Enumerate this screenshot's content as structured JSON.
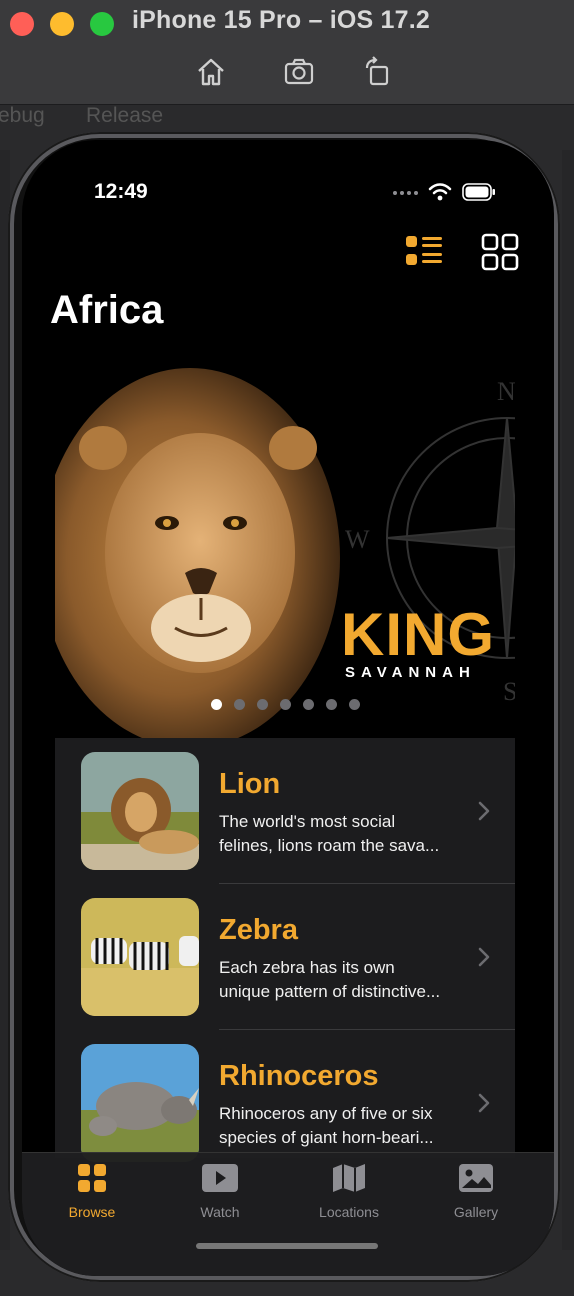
{
  "window": {
    "title": "iPhone 15 Pro – iOS 17.2",
    "behind_labels": [
      "ebug",
      "Release"
    ]
  },
  "toolbar": {
    "icons": [
      "home-icon",
      "screenshot-icon",
      "rotate-icon"
    ]
  },
  "status_bar": {
    "time": "12:49"
  },
  "header": {
    "title": "Africa",
    "view_toggles": [
      "list-view-icon",
      "grid-view-icon"
    ]
  },
  "hero": {
    "headline": "KING",
    "subheadline": "SAVANNAH",
    "compass_letters": [
      "N",
      "W",
      "S"
    ],
    "page_count": 7,
    "current_page": 1
  },
  "animals": [
    {
      "name": "Lion",
      "desc_line1": "The world's most social",
      "desc_line2": "felines, lions roam the sava..."
    },
    {
      "name": "Zebra",
      "desc_line1": "Each zebra has its own",
      "desc_line2": "unique pattern of distinctive..."
    },
    {
      "name": "Rhinoceros",
      "desc_line1": "Rhinoceros any of five or six",
      "desc_line2": "species of giant horn-beari..."
    }
  ],
  "tabs": [
    {
      "label": "Browse",
      "icon": "browse-icon",
      "active": true
    },
    {
      "label": "Watch",
      "icon": "watch-icon",
      "active": false
    },
    {
      "label": "Locations",
      "icon": "map-icon",
      "active": false
    },
    {
      "label": "Gallery",
      "icon": "gallery-icon",
      "active": false
    }
  ],
  "colors": {
    "accent": "#f2a930",
    "background": "#000000",
    "list_bg": "#1c1c1e"
  }
}
